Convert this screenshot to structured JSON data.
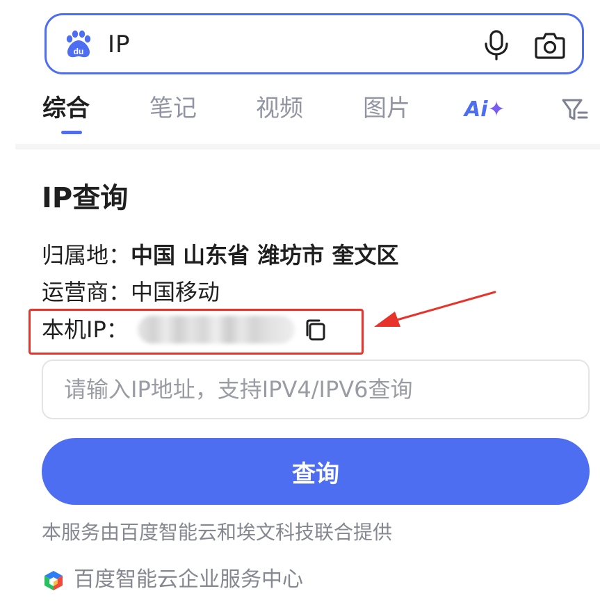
{
  "search": {
    "query": "IP",
    "logo_text": "du"
  },
  "tabs": [
    {
      "label": "综合",
      "active": true
    },
    {
      "label": "笔记",
      "active": false
    },
    {
      "label": "视频",
      "active": false
    },
    {
      "label": "图片",
      "active": false
    }
  ],
  "ai_tab": {
    "label": "Ai",
    "sparkle": "✦"
  },
  "ip_card": {
    "title": "IP查询",
    "location_label": "归属地：",
    "location_value": "中国 山东省 潍坊市 奎文区",
    "isp_label": "运营商：",
    "isp_value": "中国移动",
    "local_ip_label": "本机IP：",
    "input_placeholder": "请输入IP地址，支持IPV4/IPV6查询",
    "button_label": "查询",
    "service_note": "本服务由百度智能云和埃文科技联合提供",
    "provider_link": "百度智能云企业服务中心"
  },
  "colors": {
    "accent": "#4e6ef2",
    "highlight_red": "#e8332b",
    "muted_text": "#858891"
  }
}
